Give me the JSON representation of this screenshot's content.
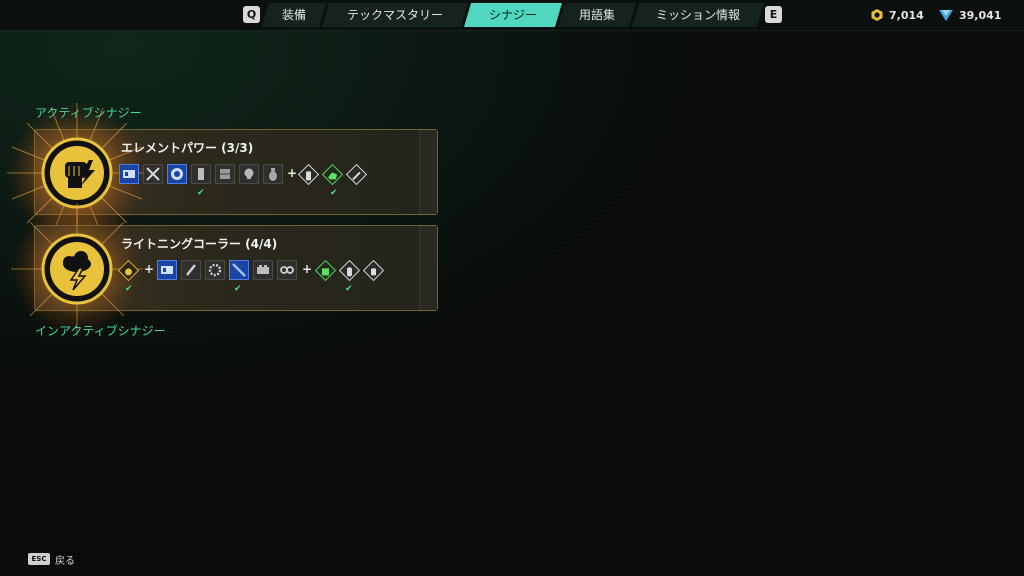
{
  "nav": {
    "prev_key": "Q",
    "next_key": "E",
    "tabs": [
      {
        "label": "装備",
        "active": false
      },
      {
        "label": "テックマスタリー",
        "active": false
      },
      {
        "label": "シナジー",
        "active": true
      },
      {
        "label": "用語集",
        "active": false
      },
      {
        "label": "ミッション情報",
        "active": false
      }
    ],
    "accent_color": "#4fd8bf"
  },
  "currencies": [
    {
      "icon": "gold-hex-coin-icon",
      "value": "7,014"
    },
    {
      "icon": "blue-crystal-icon",
      "value": "39,041"
    }
  ],
  "sections": {
    "active_label": "アクティブシナジー",
    "inactive_label": "インアクティブシナジー"
  },
  "synergies": [
    {
      "title": "エレメントパワー (3/3)",
      "emblem_icon": "raised-fist-lightning-icon",
      "items": [
        {
          "icon": "blue-chip-icon",
          "style": "blue",
          "checked": false
        },
        {
          "icon": "crossed-swords-icon",
          "style": "sq",
          "checked": false
        },
        {
          "icon": "blue-orb-icon",
          "style": "blue",
          "checked": false
        },
        {
          "icon": "canister-icon",
          "style": "sq",
          "checked": true
        },
        {
          "icon": "armor-plate-icon",
          "style": "sq",
          "checked": false
        },
        {
          "icon": "skull-icon",
          "style": "sq",
          "checked": false
        },
        {
          "icon": "grenade-icon",
          "style": "sq",
          "checked": false
        },
        {
          "icon": "vial-icon",
          "style": "dia",
          "checked": false
        },
        {
          "icon": "beast-icon",
          "style": "dia-green",
          "checked": true
        },
        {
          "icon": "wrench-icon",
          "style": "dia",
          "checked": false
        }
      ]
    },
    {
      "title": "ライトニングコーラー (4/4)",
      "emblem_icon": "storm-cloud-lightning-icon",
      "items": [
        {
          "icon": "spark-icon",
          "style": "dia-gold",
          "checked": true
        },
        {
          "icon": "blue-chip-icon",
          "style": "blue",
          "checked": false
        },
        {
          "icon": "spark-plug-icon",
          "style": "sq",
          "checked": false
        },
        {
          "icon": "gear-icon",
          "style": "sq",
          "checked": false
        },
        {
          "icon": "blue-rod-icon",
          "style": "blue",
          "checked": true
        },
        {
          "icon": "battery-icon",
          "style": "sq",
          "checked": false
        },
        {
          "icon": "goggles-icon",
          "style": "sq",
          "checked": false
        },
        {
          "icon": "robot-icon",
          "style": "dia-green",
          "checked": false
        },
        {
          "icon": "canister-icon",
          "style": "dia",
          "checked": true
        },
        {
          "icon": "vial-icon",
          "style": "dia",
          "checked": false
        }
      ]
    }
  ],
  "footer": {
    "key": "ESC",
    "label": "戻る"
  }
}
